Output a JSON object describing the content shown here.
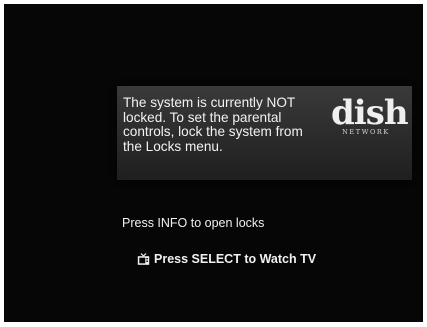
{
  "screen": {
    "background": "#060606",
    "panel_color": "#333333",
    "text_color": "#f2f2f2"
  },
  "message": {
    "line1": "The system is currently NOT",
    "line2": "locked. To set the parental",
    "line3": "controls, lock the system from",
    "line4": "the Locks menu."
  },
  "logo": {
    "word": "dish",
    "sub": "NETWORK"
  },
  "prompts": {
    "info": "Press INFO to open locks",
    "select": "Press SELECT to Watch TV",
    "select_icon": "tv-icon"
  }
}
